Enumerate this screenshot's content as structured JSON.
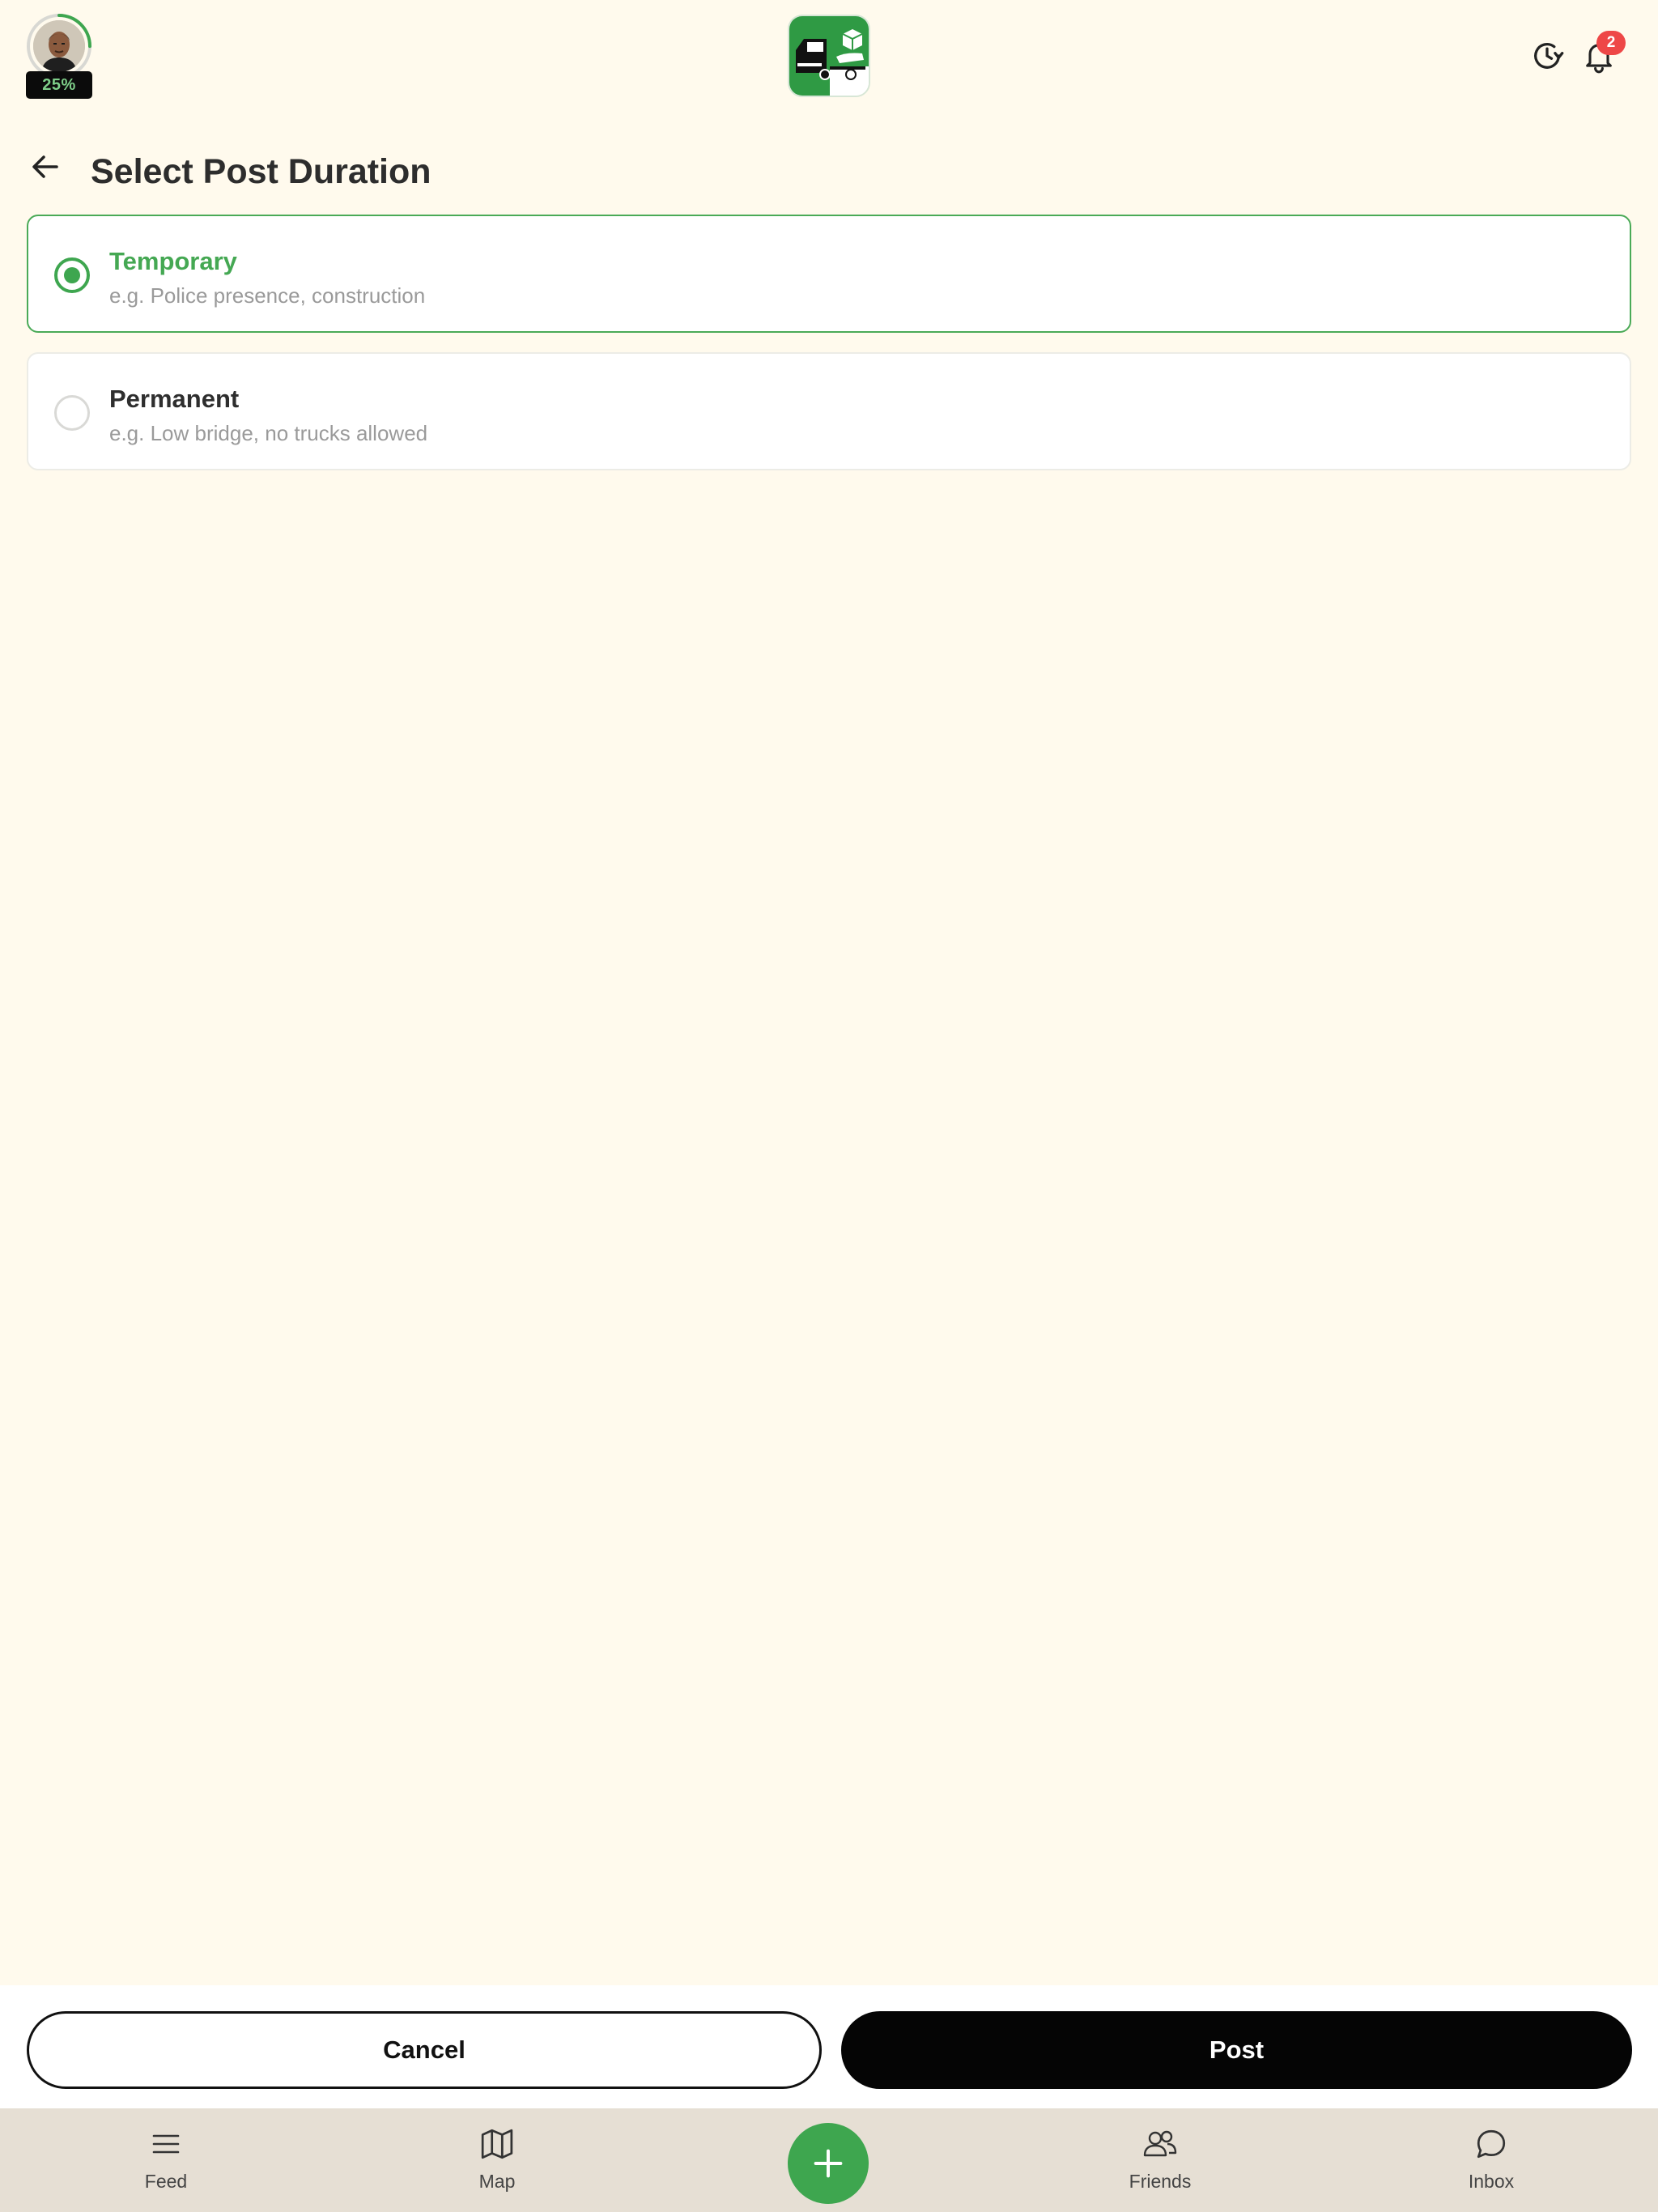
{
  "header": {
    "profile_progress": "25%",
    "profile_progress_fraction": 0.25,
    "notification_count": "2",
    "colors": {
      "accent": "#3ea64f",
      "badge": "#ee4747"
    }
  },
  "page": {
    "title": "Select Post Duration"
  },
  "options": [
    {
      "title": "Temporary",
      "subtitle": "e.g. Police presence, construction",
      "selected": true
    },
    {
      "title": "Permanent",
      "subtitle": "e.g. Low bridge, no trucks allowed",
      "selected": false
    }
  ],
  "actions": {
    "cancel_label": "Cancel",
    "post_label": "Post"
  },
  "tabs": {
    "feed": "Feed",
    "map": "Map",
    "friends": "Friends",
    "inbox": "Inbox"
  }
}
